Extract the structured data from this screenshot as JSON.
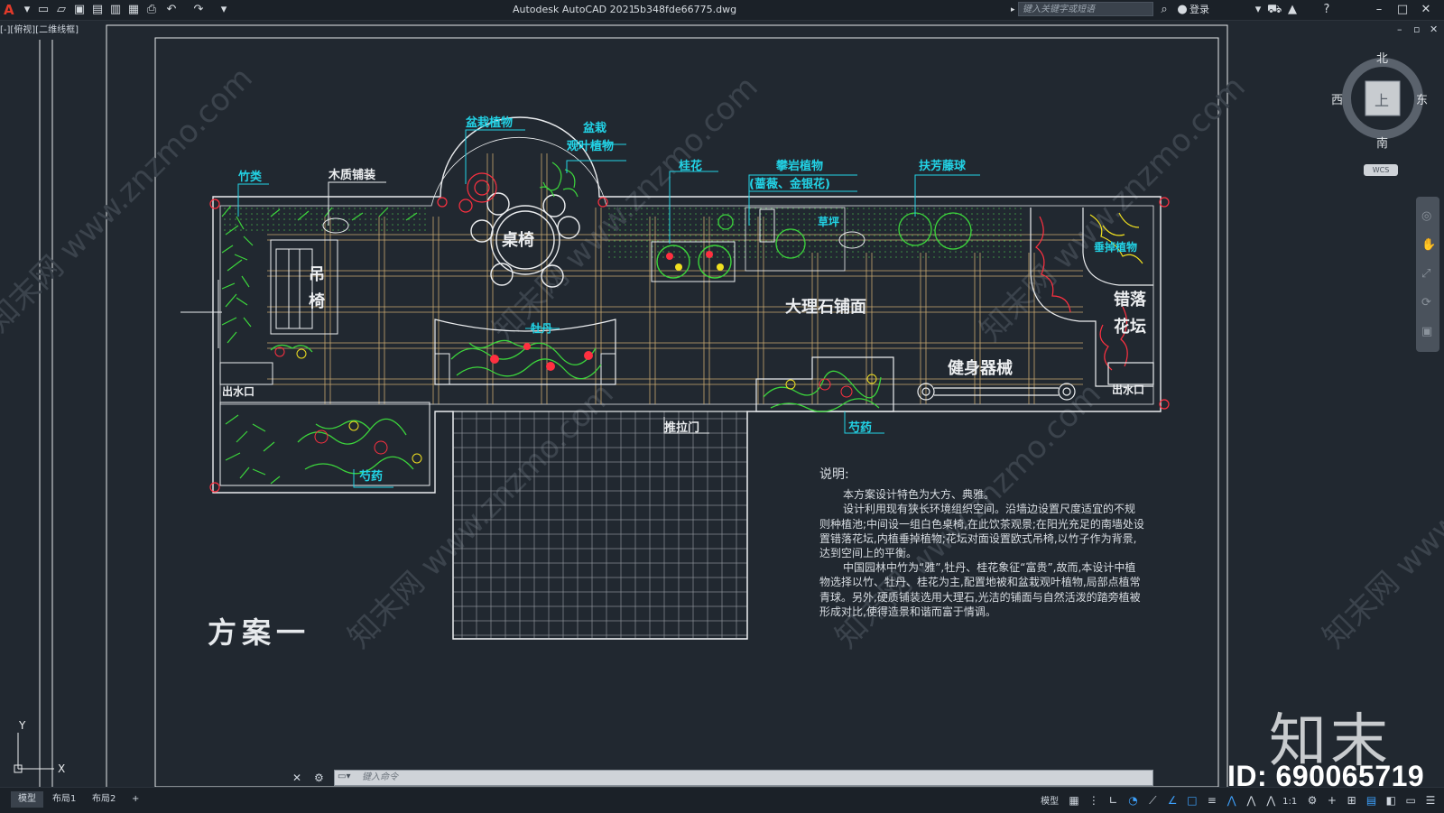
{
  "app": {
    "title": "Autodesk AutoCAD 2021",
    "filename": "5b348fde66775.dwg",
    "search_placeholder": "键入关键字或短语",
    "login_label": "登录",
    "viewport_label": "[-][俯视][二维线框]"
  },
  "compass": {
    "north": "北",
    "south": "南",
    "east": "东",
    "west": "西",
    "top_label": "上",
    "wcs_label": "WCS"
  },
  "plan": {
    "title": "方案一",
    "labels": {
      "bamboo": "竹类",
      "wood_paving": "木质铺装",
      "potted_plants": "盆栽植物",
      "potted": "盆栽",
      "foliage_plants": "观叶植物",
      "osmanthus": "桂花",
      "climbing_plants": "攀岩植物",
      "climbing_species": "(蔷薇、金银花)",
      "boxwood_ball": "扶芳藤球",
      "lawn": "草坪",
      "hanging_plants": "垂掉植物",
      "table_chairs": "桌椅",
      "swing_chair_1": "吊",
      "swing_chair_2": "椅",
      "peony": "牡丹",
      "marble_paving": "大理石铺面",
      "staggered_1": "错落",
      "staggered_2": "花坛",
      "fitness": "健身器械",
      "outlet_left": "出水口",
      "outlet_right": "出水口",
      "sliding_door": "推拉门",
      "herbaceous_peony_left": "芍药",
      "herbaceous_peony_right": "芍药"
    }
  },
  "notes": {
    "heading": "说明:",
    "paragraphs": [
      "本方案设计特色为大方、典雅。",
      "设计利用现有狭长环境组织空间。沿墙边设置尺度适宜的不规则种植池;中间设一组白色桌椅,在此饮茶观景;在阳光充足的南墙处设置错落花坛,内植垂掉植物;花坛对面设置欧式吊椅,以竹子作为背景,达到空间上的平衡。",
      "中国园林中竹为“雅”,牡丹、桂花象征“富贵”,故而,本设计中植物选择以竹、牡丹、桂花为主,配置地被和盆栽观叶植物,局部点植常青球。另外,硬质铺装选用大理石,光洁的铺面与自然活泼的踏旁植被形成对比,使得造景和谐而富于情调。"
    ]
  },
  "command": {
    "placeholder": "键入命令"
  },
  "tabs": [
    "模型",
    "布局1",
    "布局2",
    "+"
  ],
  "status": {
    "model_label": "模型",
    "scale": "1:1"
  },
  "watermark": {
    "logo": "知末",
    "id": "ID: 690065719",
    "site": "www.znzmo.com"
  },
  "colors": {
    "line": "#f2f2f2",
    "cyan": "#22d3e6",
    "green": "#3cd63c",
    "red": "#ff3040",
    "yellow": "#f0e020",
    "tan": "#c8a870"
  }
}
